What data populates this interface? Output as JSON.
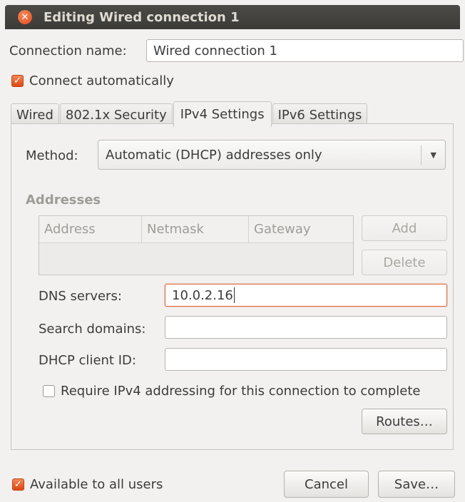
{
  "window": {
    "title": "Editing Wired connection 1"
  },
  "connection_name": {
    "label": "Connection name:",
    "value": "Wired connection 1"
  },
  "connect_automatically": {
    "label": "Connect automatically",
    "checked": true
  },
  "tabs": [
    {
      "label": "Wired",
      "active": false
    },
    {
      "label": "802.1x Security",
      "active": false
    },
    {
      "label": "IPv4 Settings",
      "active": true
    },
    {
      "label": "IPv6 Settings",
      "active": false
    }
  ],
  "ipv4": {
    "method_label": "Method:",
    "method_value": "Automatic (DHCP) addresses only",
    "addresses_heading": "Addresses",
    "columns": [
      "Address",
      "Netmask",
      "Gateway"
    ],
    "add_label": "Add",
    "delete_label": "Delete",
    "dns_label": "DNS servers:",
    "dns_value": "10.0.2.16",
    "search_label": "Search domains:",
    "search_value": "",
    "dhcp_label": "DHCP client ID:",
    "dhcp_value": "",
    "require_label": "Require IPv4 addressing for this connection to complete",
    "require_checked": false,
    "routes_label": "Routes…"
  },
  "footer": {
    "available_label": "Available to all users",
    "available_checked": true,
    "cancel_label": "Cancel",
    "save_label": "Save…"
  },
  "colors": {
    "accent": "#dd4814",
    "titlebar": "#3c3b37",
    "window_bg": "#f2f1f0"
  }
}
